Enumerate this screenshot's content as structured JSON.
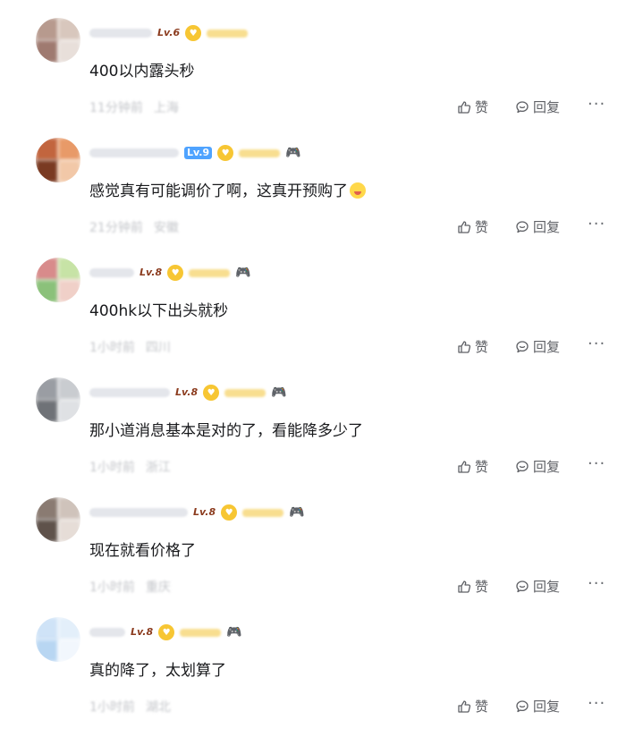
{
  "labels": {
    "like": "赞",
    "reply": "回复",
    "more": "···"
  },
  "comments": [
    {
      "level": "Lv.6",
      "text": "400以内露头秒",
      "time": "11分钟前",
      "location": "上海",
      "avatar_colors": [
        "#b79a8e",
        "#d8c7bd",
        "#9f7a70",
        "#e8dfda"
      ]
    },
    {
      "level": "Lv.9",
      "text": "感觉真有可能调价了啊，这真开预购了",
      "time": "21分钟前",
      "location": "安徽",
      "avatar_colors": [
        "#c2653e",
        "#e89a68",
        "#7a3a22",
        "#f2c8a8"
      ]
    },
    {
      "level": "Lv.8",
      "text": "400hk以下出头就秒",
      "time": "1小时前",
      "location": "四川",
      "avatar_colors": [
        "#d88b8b",
        "#c7e3a6",
        "#8bc17a",
        "#f0d0c8"
      ]
    },
    {
      "level": "Lv.8",
      "text": "那小道消息基本是对的了，看能降多少了",
      "time": "1小时前",
      "location": "浙江",
      "avatar_colors": [
        "#9a9da3",
        "#c9ccd0",
        "#6f7277",
        "#dfe1e4"
      ]
    },
    {
      "level": "Lv.8",
      "text": "现在就看价格了",
      "time": "1小时前",
      "location": "重庆",
      "avatar_colors": [
        "#8a7b72",
        "#cfc3bb",
        "#5f524b",
        "#e6ddd7"
      ]
    },
    {
      "level": "Lv.8",
      "text": "真的降了，太划算了",
      "time": "1小时前",
      "location": "湖北",
      "avatar_colors": [
        "#cfe3f7",
        "#e3effa",
        "#b8d6f2",
        "#f2f7fd"
      ]
    }
  ]
}
